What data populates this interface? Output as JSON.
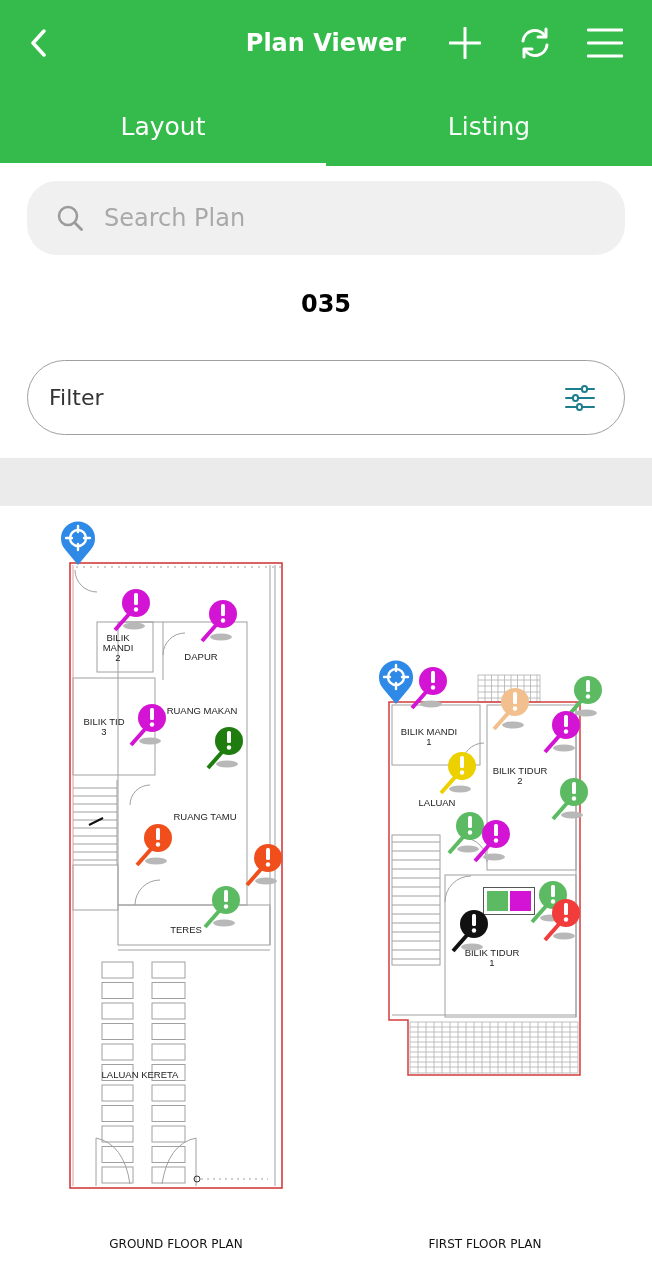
{
  "header": {
    "title": "Plan Viewer",
    "tabs": [
      {
        "label": "Layout",
        "selected": true
      },
      {
        "label": "Listing",
        "selected": false
      }
    ]
  },
  "search": {
    "placeholder": "Search Plan"
  },
  "plan_number": "035",
  "filter": {
    "label": "Filter"
  },
  "plans": [
    {
      "title": "GROUND FLOOR PLAN",
      "rooms": [
        {
          "lines": [
            "BILIK",
            "MANDI",
            "2"
          ]
        },
        {
          "lines": [
            "DAPUR"
          ]
        },
        {
          "lines": [
            "BILIK TID",
            "3"
          ]
        },
        {
          "lines": [
            "RUANG MAKAN"
          ]
        },
        {
          "lines": [
            "RUANG TAMU"
          ]
        },
        {
          "lines": [
            "TERES"
          ]
        },
        {
          "lines": [
            "LALUAN KERETA"
          ]
        }
      ],
      "pins": [
        {
          "kind": "locate"
        },
        {
          "kind": "alert",
          "color": "#d414d4"
        },
        {
          "kind": "alert",
          "color": "#d414d4"
        },
        {
          "kind": "alert",
          "color": "#d414d4"
        },
        {
          "kind": "alert",
          "color": "#1e7d0e"
        },
        {
          "kind": "alert",
          "color": "#f04f1c"
        },
        {
          "kind": "alert",
          "color": "#f04f1c"
        },
        {
          "kind": "alert",
          "color": "#5cbb62"
        }
      ]
    },
    {
      "title": "FIRST FLOOR PLAN",
      "rooms": [
        {
          "lines": [
            "BILIK MANDI",
            "1"
          ]
        },
        {
          "lines": [
            "BILIK TIDUR",
            "2"
          ]
        },
        {
          "lines": [
            "LALUAN"
          ]
        },
        {
          "lines": [
            "BILIK TIDUR",
            "1"
          ]
        }
      ],
      "pins": [
        {
          "kind": "locate"
        },
        {
          "kind": "alert",
          "color": "#d414d4"
        },
        {
          "kind": "alert",
          "color": "#5cbb62"
        },
        {
          "kind": "alert",
          "color": "#f2c08e"
        },
        {
          "kind": "alert",
          "color": "#d414d4"
        },
        {
          "kind": "alert",
          "color": "#ecd000"
        },
        {
          "kind": "alert",
          "color": "#5cbb62"
        },
        {
          "kind": "alert",
          "color": "#5cbb62"
        },
        {
          "kind": "alert",
          "color": "#d414d4"
        },
        {
          "kind": "alert",
          "color": "#5cbb62"
        },
        {
          "kind": "alert",
          "color": "#f23c3c"
        },
        {
          "kind": "alert",
          "color": "#111111"
        }
      ],
      "swatches": [
        {
          "color": "#5cbb62"
        },
        {
          "color": "#d414d4"
        }
      ]
    }
  ]
}
